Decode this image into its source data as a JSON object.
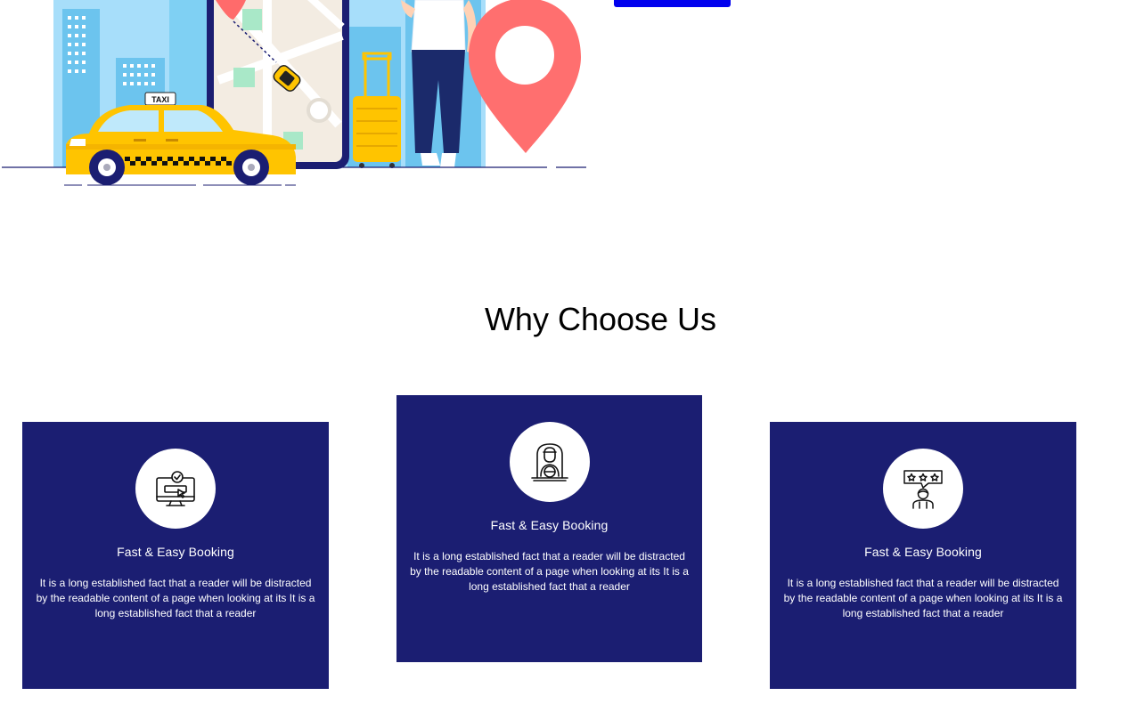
{
  "hero": {
    "taxi_sign": "TAXI",
    "cta_label": ""
  },
  "why": {
    "title": "Why Choose Us",
    "cards": [
      {
        "icon": "computer-booking-icon",
        "title": "Fast & Easy Booking",
        "text": "It is a long established fact that a reader will be distracted by the readable content of a page when looking at its It is a long established fact that a reader"
      },
      {
        "icon": "driver-icon",
        "title": "Fast & Easy Booking",
        "text": "It is a long established fact that a reader will be distracted by the readable content of a page when looking at its It is a long established fact that a reader"
      },
      {
        "icon": "rating-review-icon",
        "title": "Fast & Easy Booking",
        "text": "It is a long established fact that a reader will be distracted by the readable content of a page when looking at its It is a long established fact that a reader"
      }
    ]
  },
  "colors": {
    "card_bg": "#1b1e72",
    "cta": "#0000ee",
    "taxi_yellow": "#ffc400",
    "pin_red": "#ff6b6b"
  }
}
